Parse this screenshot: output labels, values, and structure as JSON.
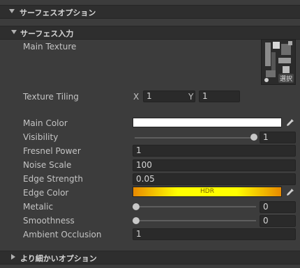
{
  "sections": {
    "surface_options": "サーフェスオプション",
    "surface_inputs": "サーフェス入力",
    "advanced_options": "より細かいオプション"
  },
  "main_texture": {
    "label": "Main Texture",
    "select_label": "選択"
  },
  "texture_tiling": {
    "label": "Texture Tiling",
    "x_label": "X",
    "x_value": "1",
    "y_label": "Y",
    "y_value": "1"
  },
  "main_color": {
    "label": "Main Color",
    "color": "#ffffff"
  },
  "visibility": {
    "label": "Visibility",
    "value": "1",
    "fraction": 1.0
  },
  "fresnel_power": {
    "label": "Fresnel Power",
    "value": "1"
  },
  "noise_scale": {
    "label": "Noise Scale",
    "value": "100"
  },
  "edge_strength": {
    "label": "Edge Strength",
    "value": "0.05"
  },
  "edge_color": {
    "label": "Edge Color",
    "badge": "HDR",
    "colors": [
      "#e88a00",
      "#ffff00",
      "#e88a00"
    ]
  },
  "metalic": {
    "label": "Metalic",
    "value": "0",
    "fraction": 0.0
  },
  "smoothness": {
    "label": "Smoothness",
    "value": "0",
    "fraction": 0.0
  },
  "ambient_occlusion": {
    "label": "Ambient Occlusion",
    "value": "1"
  }
}
